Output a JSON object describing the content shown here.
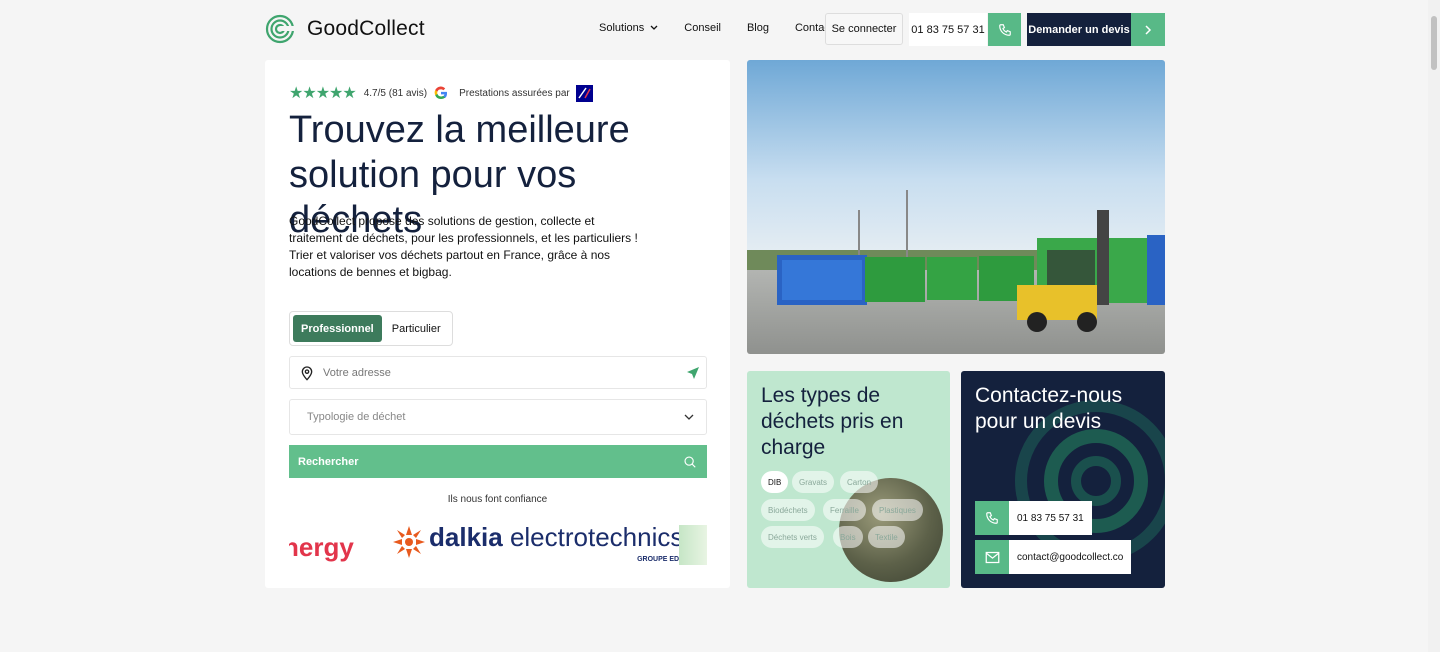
{
  "brand": {
    "name": "GoodCollect"
  },
  "nav": {
    "solutions": "Solutions",
    "conseil": "Conseil",
    "blog": "Blog",
    "contact": "Contact"
  },
  "header": {
    "login": "Se connecter",
    "phone": "01 83 75 57 31",
    "devis": "Demander un devis"
  },
  "hero": {
    "rating": "4.7/5 (81 avis)",
    "stars": 5,
    "insured": "Prestations assurées par",
    "title": "Trouvez la meilleure solution pour vos déchets",
    "description": "GoodCollect propose des solutions de gestion, collecte et traitement de déchets, pour les professionnels, et les particuliers ! Trier et valoriser vos déchets partout en France, grâce à nos locations de bennes et bigbag."
  },
  "form": {
    "tab_pro": "Professionnel",
    "tab_part": "Particulier",
    "address_placeholder": "Votre adresse",
    "waste_type_placeholder": "Typologie de déchet",
    "search_label": "Rechercher"
  },
  "trust": {
    "label": "Ils nous font confiance",
    "logo_energy": "nergy",
    "logo_dalkia": "dalkia",
    "logo_dalkia_rest": " electrotechnics",
    "logo_dalkia_sub": "GROUPE EDF"
  },
  "types_card": {
    "title": "Les types de déchets pris en charge",
    "chips": [
      "DIB",
      "Gravats",
      "Carton",
      "Biodéchets",
      "Ferraille",
      "Plastiques",
      "Déchets verts",
      "Bois",
      "Textile"
    ]
  },
  "contact_card": {
    "title": "Contactez-nous pour un devis",
    "phone": "01 83 75 57 31",
    "email": "contact@goodcollect.co"
  },
  "colors": {
    "navy": "#14213d",
    "green": "#58b987",
    "dark_green": "#3d7b5c",
    "mint": "#bfe7cf"
  }
}
